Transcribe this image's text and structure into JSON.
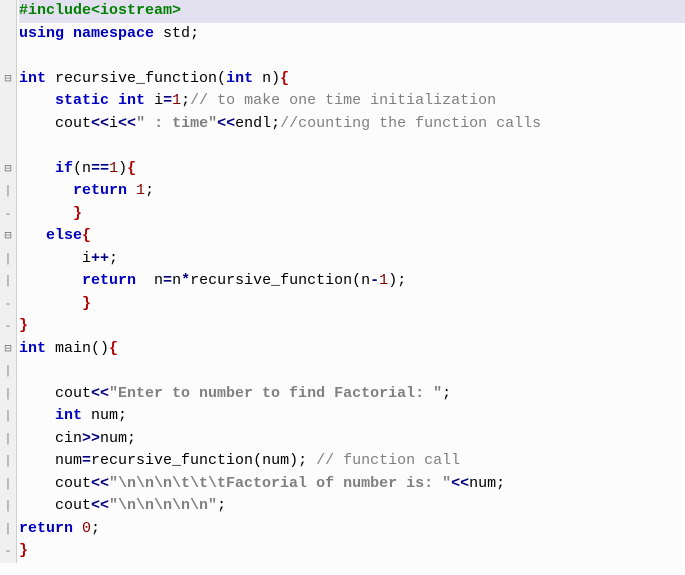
{
  "lines": [
    {
      "hl": true,
      "gutter": "",
      "tokens": [
        {
          "cls": "pp",
          "t": "#include"
        },
        {
          "cls": "inc",
          "t": "<iostream>"
        }
      ]
    },
    {
      "gutter": "",
      "tokens": [
        {
          "cls": "k",
          "t": "using"
        },
        {
          "cls": "id",
          "t": " "
        },
        {
          "cls": "k",
          "t": "namespace"
        },
        {
          "cls": "id",
          "t": " std"
        },
        {
          "cls": "p",
          "t": ";"
        }
      ]
    },
    {
      "gutter": "",
      "tokens": []
    },
    {
      "gutter": "⊟",
      "tokens": [
        {
          "cls": "k",
          "t": "int"
        },
        {
          "cls": "id",
          "t": " recursive_function"
        },
        {
          "cls": "p",
          "t": "("
        },
        {
          "cls": "k",
          "t": "int"
        },
        {
          "cls": "id",
          "t": " n"
        },
        {
          "cls": "p",
          "t": ")"
        },
        {
          "cls": "brace",
          "t": "{"
        }
      ]
    },
    {
      "gutter": "",
      "tokens": [
        {
          "cls": "id",
          "t": "    "
        },
        {
          "cls": "k",
          "t": "static"
        },
        {
          "cls": "id",
          "t": " "
        },
        {
          "cls": "k",
          "t": "int"
        },
        {
          "cls": "id",
          "t": " i"
        },
        {
          "cls": "op",
          "t": "="
        },
        {
          "cls": "n",
          "t": "1"
        },
        {
          "cls": "p",
          "t": ";"
        },
        {
          "cls": "c",
          "t": "// to make one time initialization"
        }
      ]
    },
    {
      "gutter": "",
      "tokens": [
        {
          "cls": "id",
          "t": "    cout"
        },
        {
          "cls": "op",
          "t": "<<"
        },
        {
          "cls": "id",
          "t": "i"
        },
        {
          "cls": "op",
          "t": "<<"
        },
        {
          "cls": "s",
          "t": "\" : time\""
        },
        {
          "cls": "op",
          "t": "<<"
        },
        {
          "cls": "id",
          "t": "endl"
        },
        {
          "cls": "p",
          "t": ";"
        },
        {
          "cls": "c",
          "t": "//counting the function calls"
        }
      ]
    },
    {
      "gutter": "",
      "tokens": []
    },
    {
      "gutter": "⊟",
      "tokens": [
        {
          "cls": "id",
          "t": "    "
        },
        {
          "cls": "k",
          "t": "if"
        },
        {
          "cls": "p",
          "t": "("
        },
        {
          "cls": "id",
          "t": "n"
        },
        {
          "cls": "op",
          "t": "=="
        },
        {
          "cls": "n",
          "t": "1"
        },
        {
          "cls": "p",
          "t": ")"
        },
        {
          "cls": "brace",
          "t": "{"
        }
      ]
    },
    {
      "gutter": "|",
      "tokens": [
        {
          "cls": "id",
          "t": "      "
        },
        {
          "cls": "k",
          "t": "return"
        },
        {
          "cls": "id",
          "t": " "
        },
        {
          "cls": "n",
          "t": "1"
        },
        {
          "cls": "p",
          "t": ";"
        }
      ]
    },
    {
      "gutter": "-",
      "tokens": [
        {
          "cls": "id",
          "t": "      "
        },
        {
          "cls": "brace",
          "t": "}"
        }
      ]
    },
    {
      "gutter": "⊟",
      "tokens": [
        {
          "cls": "id",
          "t": "   "
        },
        {
          "cls": "k",
          "t": "else"
        },
        {
          "cls": "brace",
          "t": "{"
        }
      ]
    },
    {
      "gutter": "|",
      "tokens": [
        {
          "cls": "id",
          "t": "       i"
        },
        {
          "cls": "op",
          "t": "++"
        },
        {
          "cls": "p",
          "t": ";"
        }
      ]
    },
    {
      "gutter": "|",
      "tokens": [
        {
          "cls": "id",
          "t": "       "
        },
        {
          "cls": "k",
          "t": "return"
        },
        {
          "cls": "id",
          "t": "  n"
        },
        {
          "cls": "op",
          "t": "="
        },
        {
          "cls": "id",
          "t": "n"
        },
        {
          "cls": "op",
          "t": "*"
        },
        {
          "cls": "id",
          "t": "recursive_function"
        },
        {
          "cls": "p",
          "t": "("
        },
        {
          "cls": "id",
          "t": "n"
        },
        {
          "cls": "op",
          "t": "-"
        },
        {
          "cls": "n",
          "t": "1"
        },
        {
          "cls": "p",
          "t": ")"
        },
        {
          "cls": "p",
          "t": ";"
        }
      ]
    },
    {
      "gutter": "-",
      "tokens": [
        {
          "cls": "id",
          "t": "       "
        },
        {
          "cls": "brace",
          "t": "}"
        }
      ]
    },
    {
      "gutter": "-",
      "tokens": [
        {
          "cls": "brace",
          "t": "}"
        }
      ]
    },
    {
      "gutter": "⊟",
      "tokens": [
        {
          "cls": "k",
          "t": "int"
        },
        {
          "cls": "id",
          "t": " main"
        },
        {
          "cls": "p",
          "t": "()"
        },
        {
          "cls": "brace",
          "t": "{"
        }
      ]
    },
    {
      "gutter": "|",
      "tokens": []
    },
    {
      "gutter": "|",
      "tokens": [
        {
          "cls": "id",
          "t": "    cout"
        },
        {
          "cls": "op",
          "t": "<<"
        },
        {
          "cls": "s",
          "t": "\"Enter to number to find Factorial: \""
        },
        {
          "cls": "p",
          "t": ";"
        }
      ]
    },
    {
      "gutter": "|",
      "tokens": [
        {
          "cls": "id",
          "t": "    "
        },
        {
          "cls": "k",
          "t": "int"
        },
        {
          "cls": "id",
          "t": " num"
        },
        {
          "cls": "p",
          "t": ";"
        }
      ]
    },
    {
      "gutter": "|",
      "tokens": [
        {
          "cls": "id",
          "t": "    cin"
        },
        {
          "cls": "op",
          "t": ">>"
        },
        {
          "cls": "id",
          "t": "num"
        },
        {
          "cls": "p",
          "t": ";"
        }
      ]
    },
    {
      "gutter": "|",
      "tokens": [
        {
          "cls": "id",
          "t": "    num"
        },
        {
          "cls": "op",
          "t": "="
        },
        {
          "cls": "id",
          "t": "recursive_function"
        },
        {
          "cls": "p",
          "t": "("
        },
        {
          "cls": "id",
          "t": "num"
        },
        {
          "cls": "p",
          "t": ")"
        },
        {
          "cls": "p",
          "t": ";"
        },
        {
          "cls": "id",
          "t": " "
        },
        {
          "cls": "c",
          "t": "// function call"
        }
      ]
    },
    {
      "gutter": "|",
      "tokens": [
        {
          "cls": "id",
          "t": "    cout"
        },
        {
          "cls": "op",
          "t": "<<"
        },
        {
          "cls": "s",
          "t": "\"\\n\\n\\n\\t\\t\\tFactorial of number is: \""
        },
        {
          "cls": "op",
          "t": "<<"
        },
        {
          "cls": "id",
          "t": "num"
        },
        {
          "cls": "p",
          "t": ";"
        }
      ]
    },
    {
      "gutter": "|",
      "tokens": [
        {
          "cls": "id",
          "t": "    cout"
        },
        {
          "cls": "op",
          "t": "<<"
        },
        {
          "cls": "s",
          "t": "\"\\n\\n\\n\\n\\n\""
        },
        {
          "cls": "p",
          "t": ";"
        }
      ]
    },
    {
      "gutter": "|",
      "tokens": [
        {
          "cls": "k",
          "t": "return"
        },
        {
          "cls": "id",
          "t": " "
        },
        {
          "cls": "n",
          "t": "0"
        },
        {
          "cls": "p",
          "t": ";"
        }
      ]
    },
    {
      "gutter": "-",
      "tokens": [
        {
          "cls": "brace",
          "t": "}"
        }
      ]
    }
  ]
}
